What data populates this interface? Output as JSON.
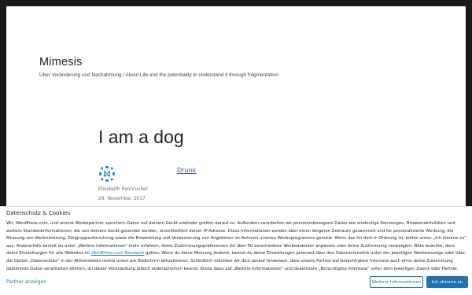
{
  "site": {
    "title": "Mimesis",
    "description": "Über Veränderung und Nachahmung / About Life and the potentiality to understand it through fragmentation"
  },
  "post": {
    "title": "I am a dog",
    "author": "Elisabeth Pannrucker",
    "date": "29. November 2017",
    "category": "Drunk",
    "avatar_icon": "geometric-pattern-avatar"
  },
  "cookie": {
    "title": "Datenschutz & Cookies",
    "text_1": "Wir, WordPress.com, und unsere Werbepartner speichern Daten auf deinem Gerät und/oder greifen darauf zu. Außerdem verarbeiten wir personenbezogene Daten wie eindeutige Kennungen, Browseraktivitäten und weitere Standardinformationen, die von deinem Gerät gesendet werden, einschließlich deiner IP-Adresse. Diese Informationen werden über einen längeren Zeitraum gesammelt und für personalisierte Werbung, die Messung von Werbeleistung, Zielgruppenforschung sowie die Entwicklung und Verbesserung von Angeboten im Rahmen unseres Werbeprogramms genutzt. Wenn das für dich in Ordnung ist, wähle unten „Ich stimme zu“ aus. Andererfalls kannst du unter „Weitere Informationen“ mehr erfahren, deine Zustimmungspräferenzen für über 50 verschiedene Werbeanbieter anpassen oder deine Zustimmung verweigern. Bitte beachte, dass deine Einstellungen für alle Websites im",
    "link_text": "WordPress.com-Netzwerk",
    "text_2": "gelten. Wenn du deine Meinung änderst, kannst du deine Einstellungen jederzeit über den Datenschutzlink unter der jeweiligen Werbeanzeige oder über die Option „Datenschutz“ in der Aktionsleiste rechts unten am Bildschirm aktualisieren. Schließlich möchten wir dich darauf hinweisen, dass unsere Partner bei berechtigtem Interesse auch ohne deine Zustimmung bestimmte Daten verarbeiten können, du dieser Verarbeitung jedoch widersprechen kannst. Klicke dazu auf „Weitere Informationen“ und deaktiviere „Berechtigtes Interesse“ unter dem jeweiligen Zweck oder Partner.",
    "partner_link": "Partner anzeigen",
    "more_info_label": "Weitere Informationen",
    "agree_label": "Ich stimme zu"
  },
  "colors": {
    "link": "#2271b1",
    "avatar": "#2c8ec4"
  }
}
